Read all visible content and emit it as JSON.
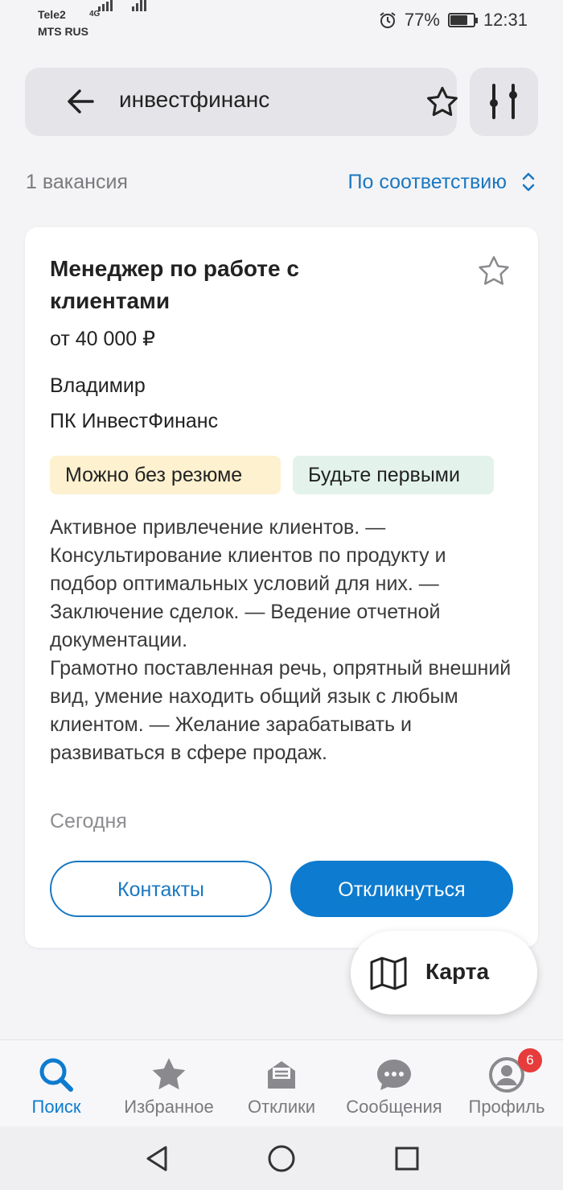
{
  "status_bar": {
    "carrier1": "Tele2",
    "carrier2": "MTS RUS",
    "network": "4G",
    "battery_percent": "77%",
    "battery_level": 0.77,
    "time": "12:31"
  },
  "search": {
    "query": "инвестфинанс"
  },
  "results": {
    "count": "1 вакансия",
    "sort_label": "По соответствию"
  },
  "vacancy": {
    "title": "Менеджер по работе с клиентами",
    "salary": "от 40 000 ₽",
    "person": "Владимир",
    "company": "ПК ИнвестФинанс",
    "tags": [
      "Можно без резюме",
      "Будьте первыми"
    ],
    "description": "Активное привлечение клиентов. —\nКонсультирование клиентов по продукту и подбор оптимальных условий для них. — Заключение сделок. — Ведение отчетной документации.\nГрамотно поставленная речь, опрятный внешний вид, умение находить общий язык с любым клиентом. — Желание зарабатывать и развиваться в сфере продаж.",
    "date": "Сегодня",
    "contacts_label": "Контакты",
    "apply_label": "Откликнуться"
  },
  "map_button": {
    "label": "Карта"
  },
  "bottom_nav": {
    "items": [
      {
        "label": "Поиск",
        "icon": "search-icon"
      },
      {
        "label": "Избранное",
        "icon": "star-icon"
      },
      {
        "label": "Отклики",
        "icon": "envelope-icon"
      },
      {
        "label": "Сообщения",
        "icon": "chat-icon"
      },
      {
        "label": "Профиль",
        "icon": "profile-icon"
      }
    ],
    "profile_badge": "6"
  },
  "colors": {
    "accent": "#0d7bcf",
    "tag_yellow": "#fdf1cf",
    "tag_green": "#e3f3ec",
    "badge": "#e63c3c"
  }
}
